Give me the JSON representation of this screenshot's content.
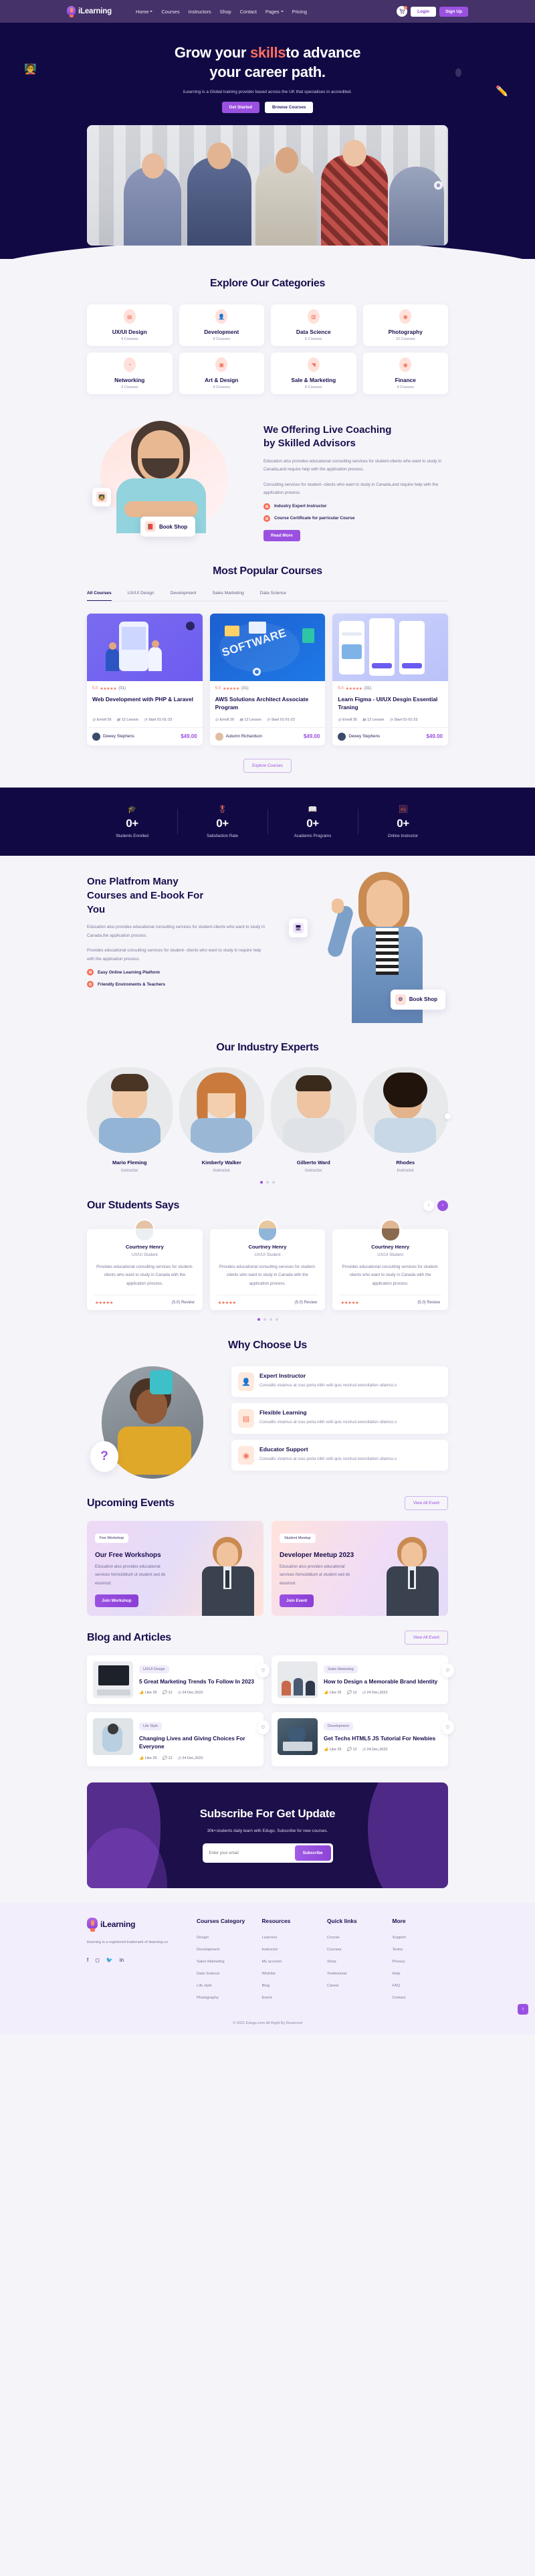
{
  "brand": {
    "name": "iLearning",
    "logo_icon": "flame-logo-icon"
  },
  "nav": {
    "links": [
      {
        "label": "Home",
        "dropdown": true
      },
      {
        "label": "Courses",
        "dropdown": false
      },
      {
        "label": "Instructors",
        "dropdown": false
      },
      {
        "label": "Shop",
        "dropdown": false
      },
      {
        "label": "Contact",
        "dropdown": false
      },
      {
        "label": "Pages",
        "dropdown": true
      },
      {
        "label": "Pricing",
        "dropdown": false
      }
    ],
    "cart_icon": "shopping-cart-icon",
    "cart_count": "0",
    "login": "Login",
    "signup": "Sign Up"
  },
  "hero": {
    "title_a": "Grow your ",
    "title_hl": "skills",
    "title_b": "to advance",
    "title_line2": "your career path.",
    "subtitle": "iLearning is a Global training provider based across the UK that specialises in accredited.",
    "btn_primary": "Get Started",
    "btn_secondary": "Browse Courses",
    "icon_left": "presentation-board-icon",
    "icon_right": "pencil-icon",
    "photo_alt": "group-of-students-photo"
  },
  "categories": {
    "title": "Explore Our Categories",
    "items": [
      {
        "name": "UX/UI Design",
        "count": "4 Courses",
        "icon": "ux-window-icon"
      },
      {
        "name": "Development",
        "count": "9 Courses",
        "icon": "developer-person-icon"
      },
      {
        "name": "Data Science",
        "count": "5 Courses",
        "icon": "data-building-icon"
      },
      {
        "name": "Photography",
        "count": "12 Courses",
        "icon": "camera-icon"
      },
      {
        "name": "Networking",
        "count": "3 Courses",
        "icon": "network-signal-icon"
      },
      {
        "name": "Art & Design",
        "count": "4 Courses",
        "icon": "art-palette-icon"
      },
      {
        "name": "Sale & Marketing",
        "count": "8 Courses",
        "icon": "megaphone-icon"
      },
      {
        "name": "Finance",
        "count": "4 Courses",
        "icon": "coins-icon"
      }
    ]
  },
  "coaching": {
    "title_line1": "We Offering Live Coaching",
    "title_line2": "by Skilled Advisors",
    "para1": "Education also provides educational consulting services for student-clients who want to study in Canada,and require help with the application process.",
    "para2": "Consulting services for student- clients who want to study in Canada,and require help with the application process.",
    "bullets": [
      "Industry Expert Instructor",
      "Course Certificate for parricular Course"
    ],
    "cta": "Read More",
    "float_card_label": "Book Shop",
    "float_card_icon": "open-book-icon",
    "float_badge_icon": "presentation-board-icon"
  },
  "courses": {
    "title": "Most Popular Courses",
    "tabs": [
      "All Courses",
      "UX/UI Design",
      "Development",
      "Sales Marketing",
      "Data Science"
    ],
    "active_tab": "All Courses",
    "items": [
      {
        "rating": "5.0",
        "stars": "★★★★★",
        "reviews": "(31)",
        "title": "Web Development with PHP & Laravel",
        "enroll": "Enroll 26",
        "lessons": "12 Lesson",
        "start": "Start 01-01-23",
        "author": "Dewey Stephens",
        "price": "$49.00",
        "thumb": "web-dev-illustration"
      },
      {
        "rating": "5.0",
        "stars": "★★★★★",
        "reviews": "(31)",
        "title": "AWS Solutions Architect Associate Program",
        "enroll": "Enroll 26",
        "lessons": "12 Lesson",
        "start": "Start 01-01-23",
        "author": "Autumn Richardson",
        "price": "$49.00",
        "thumb": "software-illustration"
      },
      {
        "rating": "5.0",
        "stars": "★★★★★",
        "reviews": "(31)",
        "title": "Learn Figma - UI/UX Desgin Essential Traning",
        "enroll": "Enroll 26",
        "lessons": "12 Lesson",
        "start": "Start 01-01-23",
        "author": "Dewey Stephens",
        "price": "$49.00",
        "thumb": "mobile-ui-illustration"
      }
    ],
    "explore_btn": "Explore Courses"
  },
  "stats": [
    {
      "value": "0+",
      "label": "Students Enrolled",
      "icon": "graduation-cap-icon"
    },
    {
      "value": "0+",
      "label": "Satisfaction Rate",
      "icon": "certificate-icon"
    },
    {
      "value": "0+",
      "label": "Academic Programs",
      "icon": "open-book-icon"
    },
    {
      "value": "0+",
      "label": "Online Instructor",
      "icon": "easel-board-icon"
    }
  ],
  "platform": {
    "title_line1": "One Platfrom Many",
    "title_line2": "Courses and E-book For",
    "title_line3": "You",
    "para1": "Education also provides educational consulting services for student-clients who want to study in Canada,the application process.",
    "para2": "Provides educational consulting services for student- clients who want to study in require help with the application process.",
    "bullets": [
      "Easy Online Learning Platform",
      "Friendly Enviroments & Teachers"
    ],
    "float_card_label": "Book Shop",
    "float_card_icon": "gear-badge-icon",
    "float_badge_icon": "monitor-icon"
  },
  "experts": {
    "title": "Our Industry Experts",
    "items": [
      {
        "name": "Mario Fleming",
        "role": "Instructor"
      },
      {
        "name": "Kimberly Walker",
        "role": "Instructor"
      },
      {
        "name": "Gilberto Ward",
        "role": "Instructor"
      },
      {
        "name": "Rhodes",
        "role": "Instructor"
      }
    ],
    "dots": 3,
    "active_dot": 0
  },
  "testimonials": {
    "title": "Our Students Says",
    "prev_icon": "chevron-left-icon",
    "next_icon": "chevron-right-icon",
    "items": [
      {
        "name": "Courtney Henry",
        "role": "UX/UI Student",
        "text": "Provides educational consulting services for student- clients who want to study in Canada with the application process.",
        "stars": "★★★★★",
        "review": "(5.0) Review"
      },
      {
        "name": "Courtney Henry",
        "role": "UX/UI Student",
        "text": "Provides educational consulting services for student- clients who want to study in Canada with the application process.",
        "stars": "★★★★★",
        "review": "(5.0) Review"
      },
      {
        "name": "Courtney Henry",
        "role": "UX/UI Student",
        "text": "Provides educational consulting services for student- clients who want to study in Canada with the application process.",
        "stars": "★★★★★",
        "review": "(5.0) Review"
      }
    ],
    "dots": 4,
    "active_dot": 0
  },
  "why": {
    "title": "Why Choose Us",
    "question_mark": "?",
    "items": [
      {
        "title": "Expert Instructor",
        "text": "Convallis vivamus at cras porta nibh velit quis nostrud exercitation ullamco.s",
        "icon": "instructor-badge-icon"
      },
      {
        "title": "Flexible Learning",
        "text": "Convallis vivamus at cras porta nibh velit quis nostrud exercitation ullamco.s",
        "icon": "browser-window-icon"
      },
      {
        "title": "Educator Support",
        "text": "Convallis vivamus at cras porta nibh velit quis nostrud exercitation ullamco.s",
        "icon": "headset-support-icon"
      }
    ]
  },
  "events": {
    "title": "Upcoming Events",
    "view_all": "View All Event",
    "items": [
      {
        "tag": "Fee Workshop",
        "title": "Our Free Workshops",
        "text": "Education also provides educational services forincididunt ut student sed do eiusmod.",
        "btn": "Join Workshop"
      },
      {
        "tag": "Student Meetup",
        "title": "Developer Meetup 2023",
        "text": "Education also provides educational services forincididunt ut student sed do eiusmod.",
        "btn": "Join Event"
      }
    ]
  },
  "blog": {
    "title": "Blog and Articles",
    "view_all": "View All Event",
    "items": [
      {
        "category": "UX/UI Design",
        "title": "5 Great Marketing Trends To Follow In 2023",
        "likes": "Like 25",
        "comments": "12",
        "date": "24 Dec,2022",
        "thumb": "design-desk-photo"
      },
      {
        "category": "Sales Marketing",
        "title": "How to Design a Memorable Brand Identity",
        "likes": "Like 25",
        "comments": "12",
        "date": "24 Dec,2022",
        "thumb": "team-meeting-photo"
      },
      {
        "category": "Life Style",
        "title": "Changing Lives and Giving Choices For Everyone",
        "likes": "Like 25",
        "comments": "12",
        "date": "24 Dec,2022",
        "thumb": "woman-reading-photo"
      },
      {
        "category": "Development",
        "title": "Get Techs HTML5 JS Tutorial For Newbies",
        "likes": "Like 25",
        "comments": "12",
        "date": "24 Dec,2022",
        "thumb": "developer-laptop-photo"
      }
    ]
  },
  "subscribe": {
    "title": "Subscribe For Get Update",
    "text": "30k+students daily learn with Edugo. Subscribe for new courses.",
    "placeholder": "Enter your email",
    "button": "Subscribe"
  },
  "footer": {
    "tagline": "ilearning is a registered trademark of ilearning.co",
    "socials": [
      "facebook-icon",
      "instagram-icon",
      "twitter-icon",
      "linkedin-icon"
    ],
    "columns": [
      {
        "title": "Courses Category",
        "links": [
          "Desgin",
          "Development",
          "Sales Marketing",
          "Data Science",
          "Life style",
          "Photography"
        ]
      },
      {
        "title": "Resources",
        "links": [
          "Learners",
          "Instructor",
          "My account",
          "Wishlist",
          "Blog",
          "Event"
        ]
      },
      {
        "title": "Quick links",
        "links": [
          "Course",
          "Courses",
          "Shop",
          "Testimonial",
          "Career"
        ]
      },
      {
        "title": "More",
        "links": [
          "Support",
          "Terms",
          "Privacy",
          "Help",
          "FAQ",
          "Contact"
        ]
      }
    ],
    "copyright": "© 2021 Edugo.com All Right By Reserved",
    "to_top_icon": "arrow-up-icon"
  }
}
